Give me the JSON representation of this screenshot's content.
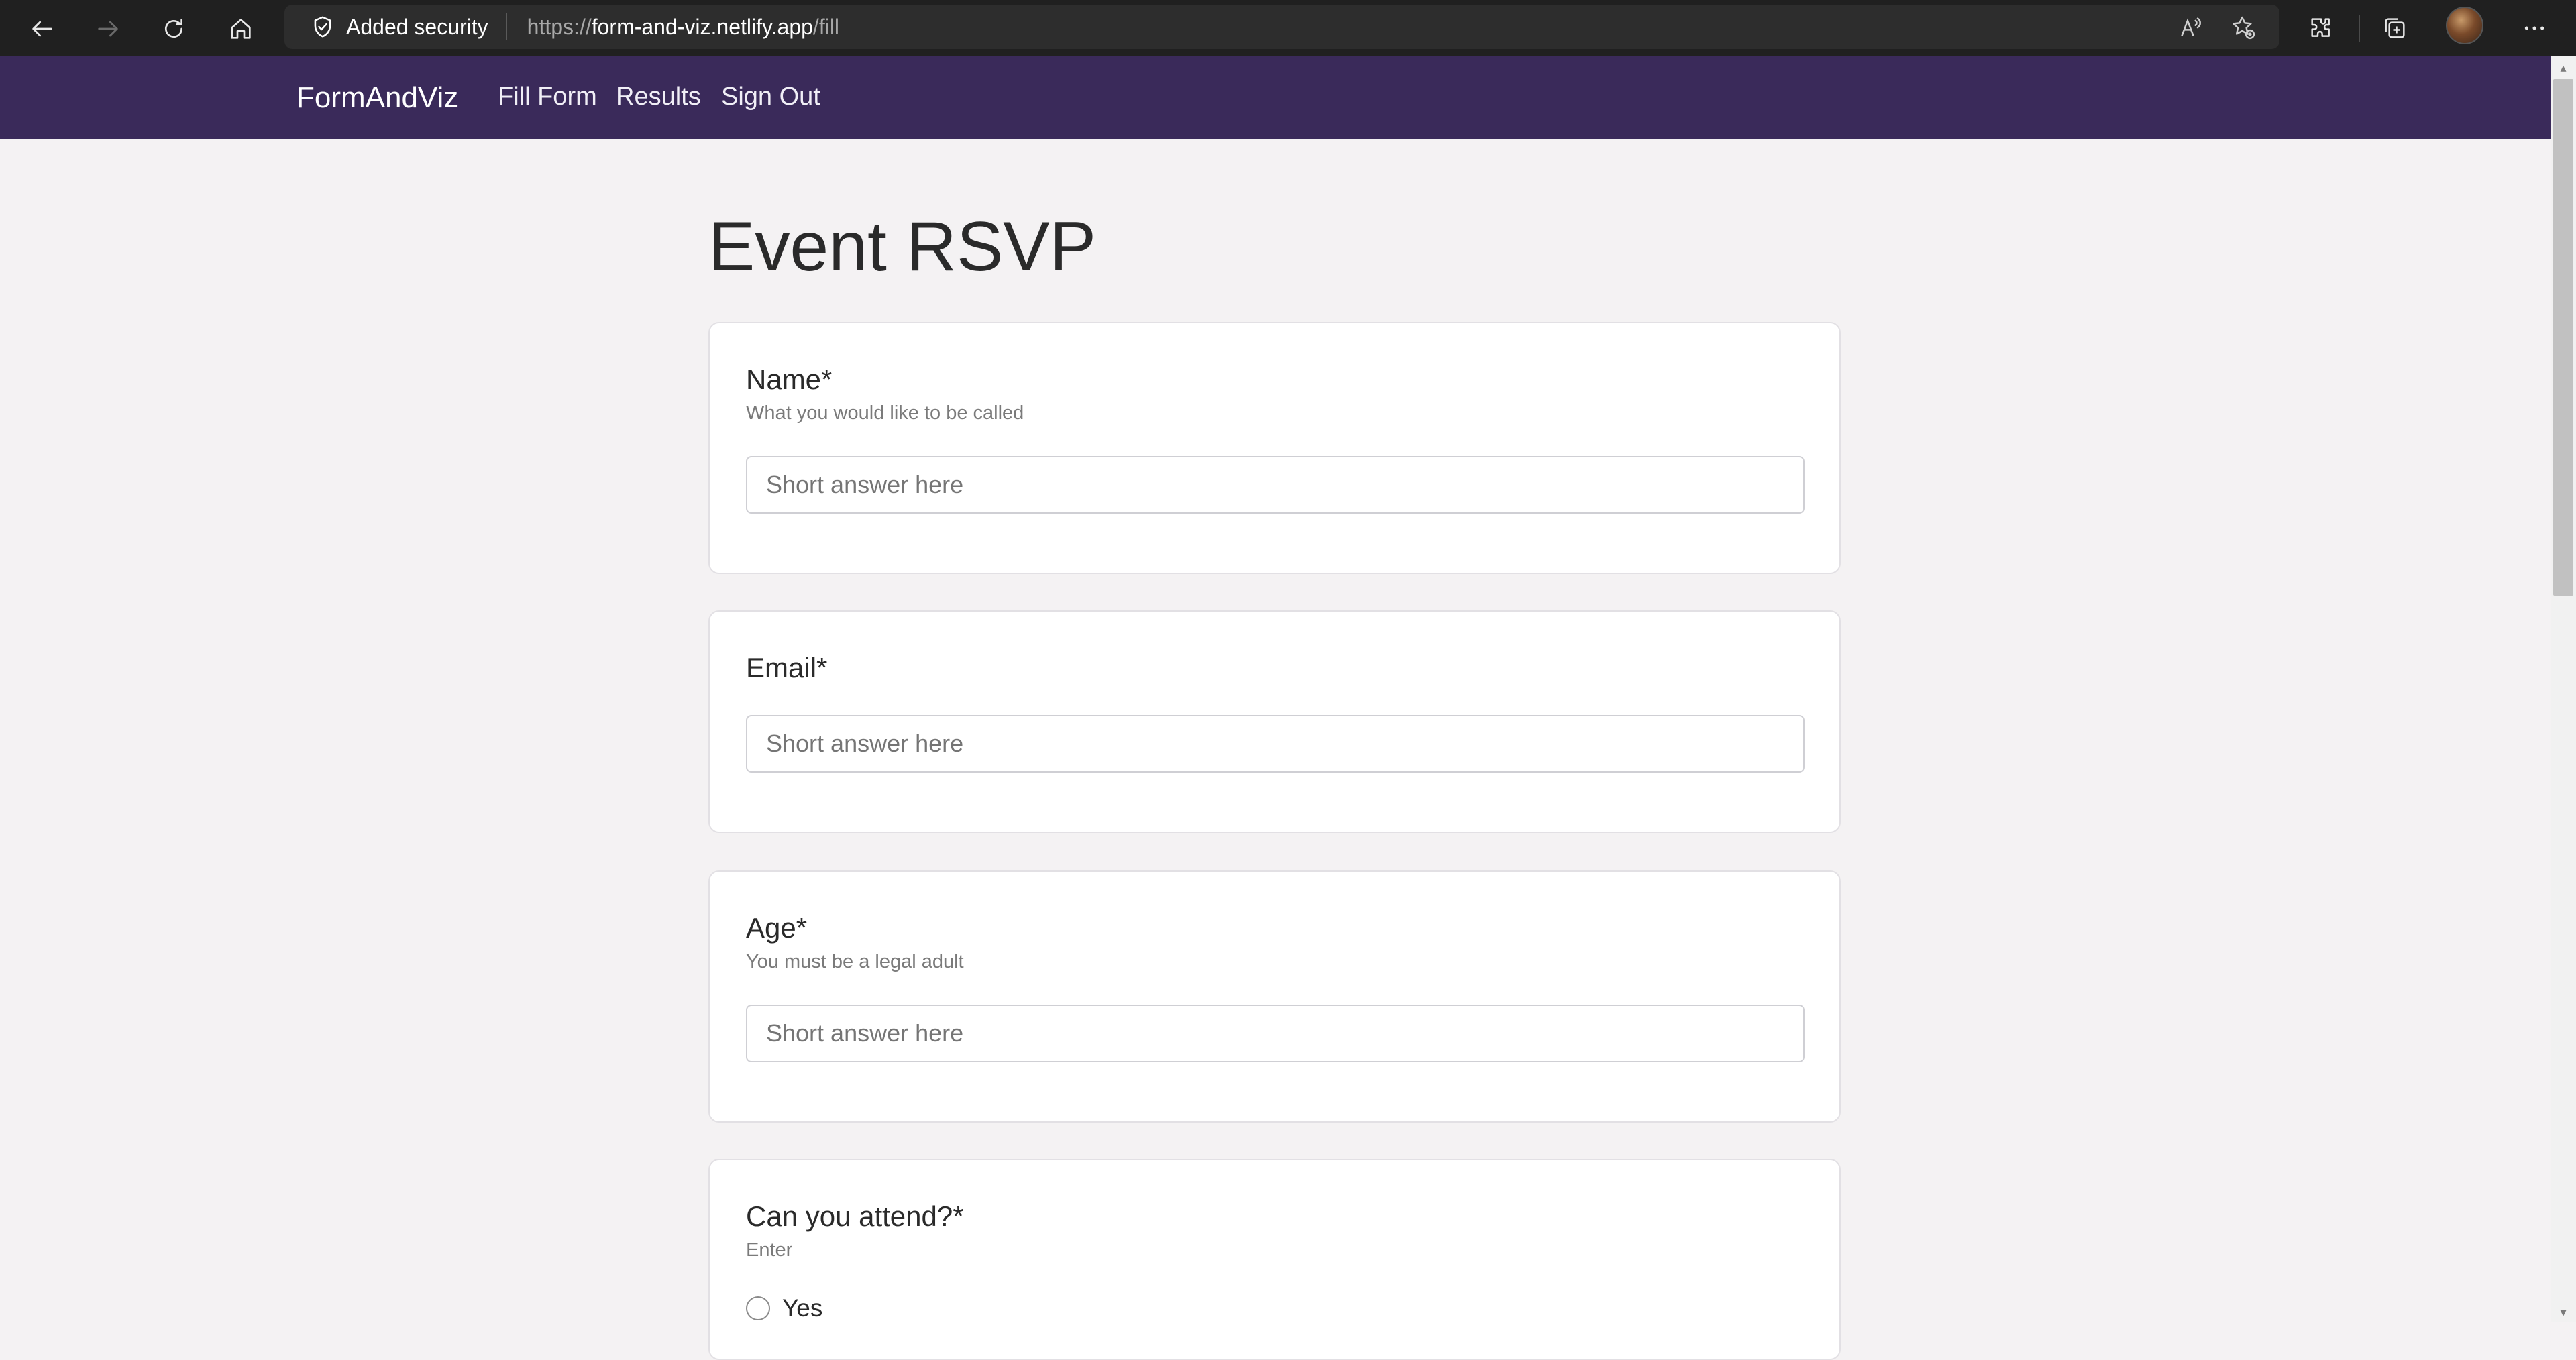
{
  "browser": {
    "security_label": "Added security",
    "url_scheme": "https://",
    "url_host": "form-and-viz.netlify.app",
    "url_path": "/fill"
  },
  "navbar": {
    "brand": "FormAndViz",
    "links": [
      "Fill Form",
      "Results",
      "Sign Out"
    ]
  },
  "form": {
    "title": "Event RSVP",
    "questions": [
      {
        "label": "Name*",
        "help": "What you would like to be called",
        "placeholder": "Short answer here"
      },
      {
        "label": "Email*",
        "help": "",
        "placeholder": "Short answer here"
      },
      {
        "label": "Age*",
        "help": "You must be a legal adult",
        "placeholder": "Short answer here"
      },
      {
        "label": "Can you attend?*",
        "help": "Enter",
        "options": [
          "Yes"
        ]
      }
    ]
  },
  "icons": {
    "back": "back-arrow-icon",
    "forward": "forward-arrow-icon",
    "refresh": "refresh-icon",
    "home": "home-icon",
    "shield": "shield-check-icon",
    "read_aloud": "read-aloud-icon",
    "favorite": "add-favorite-icon",
    "extensions": "extensions-icon",
    "collections": "collections-icon",
    "more": "more-icon"
  }
}
